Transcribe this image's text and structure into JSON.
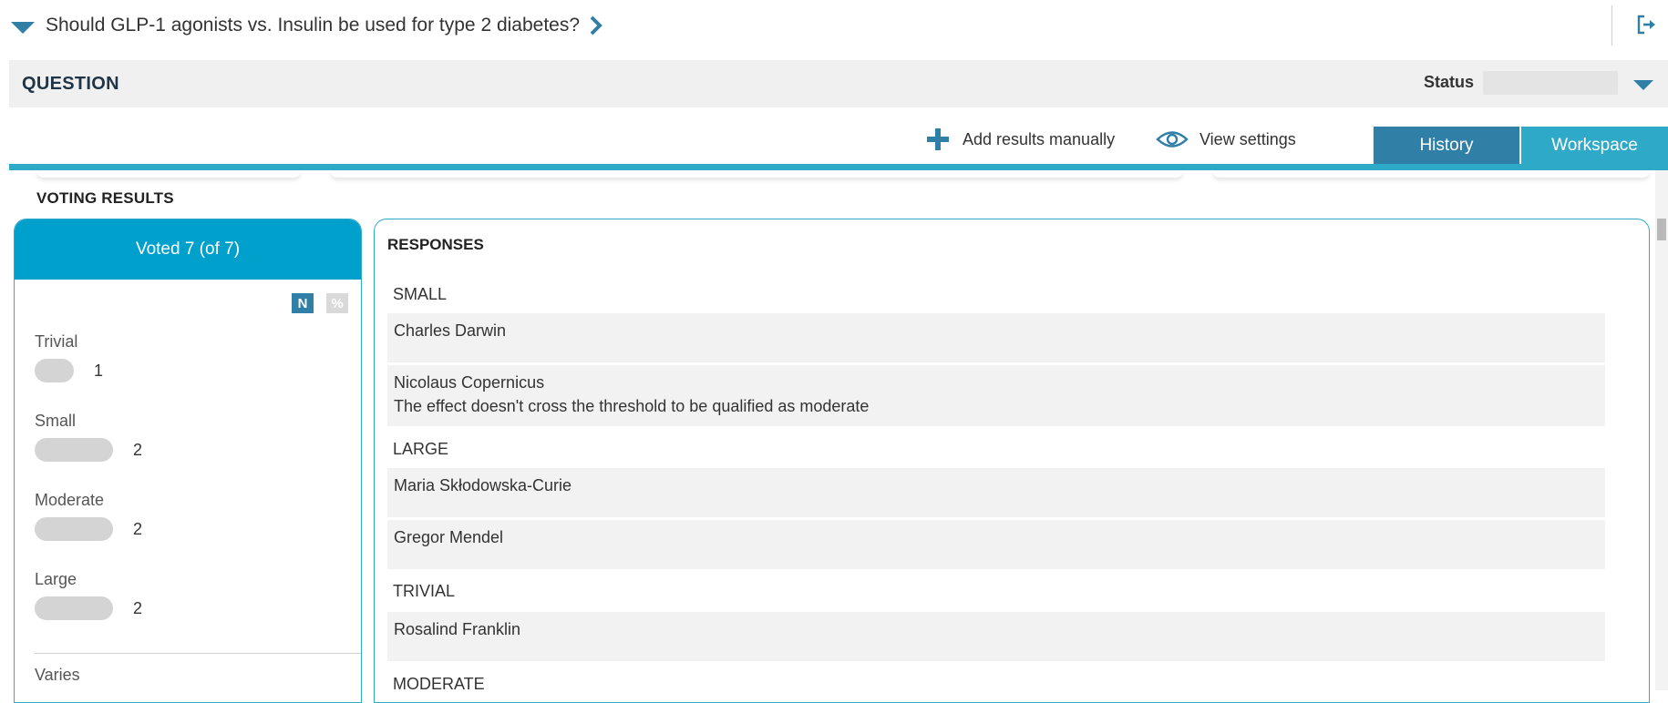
{
  "question": {
    "title": "Should GLP-1 agonists vs. Insulin be used for type 2 diabetes?"
  },
  "header": {
    "section_label": "QUESTION",
    "status_label": "Status",
    "status_value": ""
  },
  "toolbar": {
    "add_results_label": "Add results manually",
    "view_settings_label": "View settings",
    "tabs": [
      {
        "label": "History",
        "active": false
      },
      {
        "label": "Workspace",
        "active": true
      }
    ]
  },
  "voting": {
    "title": "VOTING RESULTS",
    "voted_summary": "Voted 7 (of 7)",
    "toggle_n": "N",
    "toggle_pct": "%",
    "rows": [
      {
        "label": "Trivial",
        "count": "1",
        "fraction": 0.143
      },
      {
        "label": "Small",
        "count": "2",
        "fraction": 0.286
      },
      {
        "label": "Moderate",
        "count": "2",
        "fraction": 0.286
      },
      {
        "label": "Large",
        "count": "2",
        "fraction": 0.286
      }
    ],
    "varies_label": "Varies"
  },
  "responses": {
    "title": "RESPONSES",
    "groups": [
      {
        "label": "SMALL",
        "items": [
          {
            "name": "Charles Darwin",
            "comment": ""
          },
          {
            "name": "Nicolaus Copernicus",
            "comment": "The effect doesn't cross the threshold to be qualified as moderate"
          }
        ]
      },
      {
        "label": "LARGE",
        "items": [
          {
            "name": "Maria Skłodowska-Curie",
            "comment": ""
          },
          {
            "name": "Gregor Mendel",
            "comment": ""
          }
        ]
      },
      {
        "label": "TRIVIAL",
        "items": [
          {
            "name": "Rosalind Franklin",
            "comment": ""
          }
        ]
      },
      {
        "label": "MODERATE",
        "items": []
      }
    ]
  },
  "colors": {
    "accent": "#2fa9c8",
    "primary": "#2f7fa6",
    "voted_header": "#00a0cc"
  },
  "icons": [
    "chevron-down-icon",
    "chevron-right-icon",
    "export-icon",
    "plus-icon",
    "eye-icon"
  ]
}
